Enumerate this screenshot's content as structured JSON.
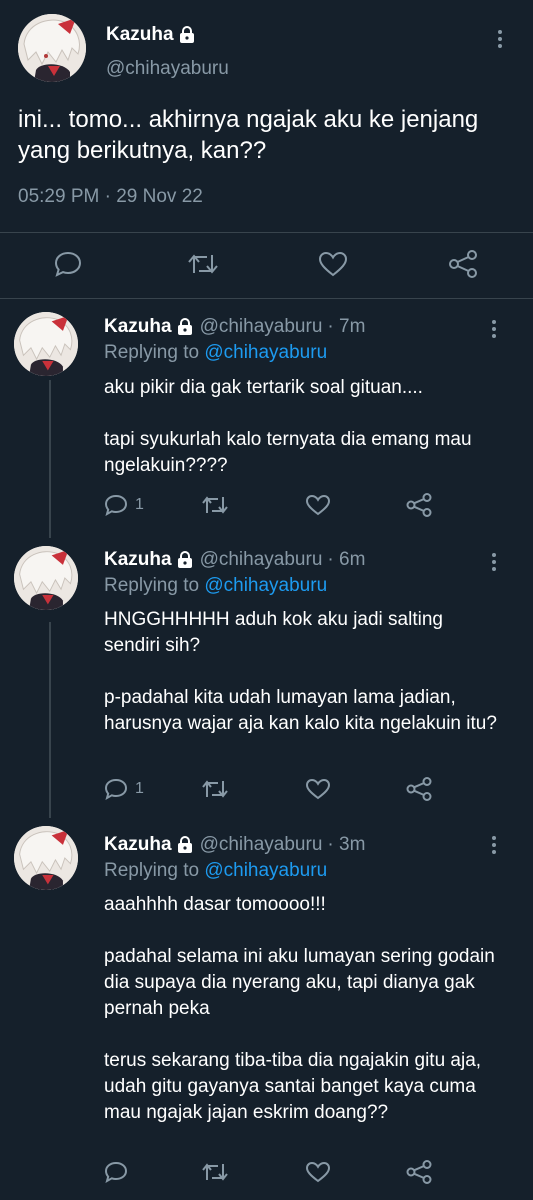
{
  "main_tweet": {
    "name": "Kazuha",
    "handle": "@chihayaburu",
    "text": "ini... tomo... akhirnya ngajak aku ke jenjang yang berikutnya, kan??",
    "timestamp": "05:29 PM · 29 Nov 22",
    "actions": [
      "reply-icon",
      "retweet-icon",
      "like-icon",
      "share-icon"
    ]
  },
  "replies": [
    {
      "name": "Kazuha",
      "handle": "@chihayaburu",
      "time": "· 7m",
      "replying_prefix": "Replying to ",
      "replying_to": "@chihayaburu",
      "paragraphs": [
        "aku pikir dia gak tertarik soal gituan....",
        "tapi syukurlah kalo ternyata dia emang mau ngelakuin????"
      ],
      "reply_count": "1"
    },
    {
      "name": "Kazuha",
      "handle": "@chihayaburu",
      "time": "· 6m",
      "replying_prefix": "Replying to ",
      "replying_to": "@chihayaburu",
      "paragraphs": [
        "HNGGHHHHH aduh kok aku jadi salting sendiri sih?",
        "p-padahal kita udah lumayan lama jadian, harusnya wajar aja kan kalo kita ngelakuin itu?"
      ],
      "reply_count": "1"
    },
    {
      "name": "Kazuha",
      "handle": "@chihayaburu",
      "time": "· 3m",
      "replying_prefix": "Replying to ",
      "replying_to": "@chihayaburu",
      "paragraphs": [
        "aaahhhh dasar tomoooo!!!",
        "padahal selama ini aku lumayan sering godain dia supaya dia nyerang aku, tapi dianya gak pernah peka",
        "terus sekarang tiba-tiba dia ngajakin gitu aja, udah gitu gayanya santai banget kaya cuma mau ngajak jajan eskrim doang??"
      ],
      "reply_count": ""
    }
  ],
  "colors": {
    "background": "#15202b",
    "muted": "#8899a6",
    "link": "#1d9bf0",
    "divider": "#38444d"
  }
}
